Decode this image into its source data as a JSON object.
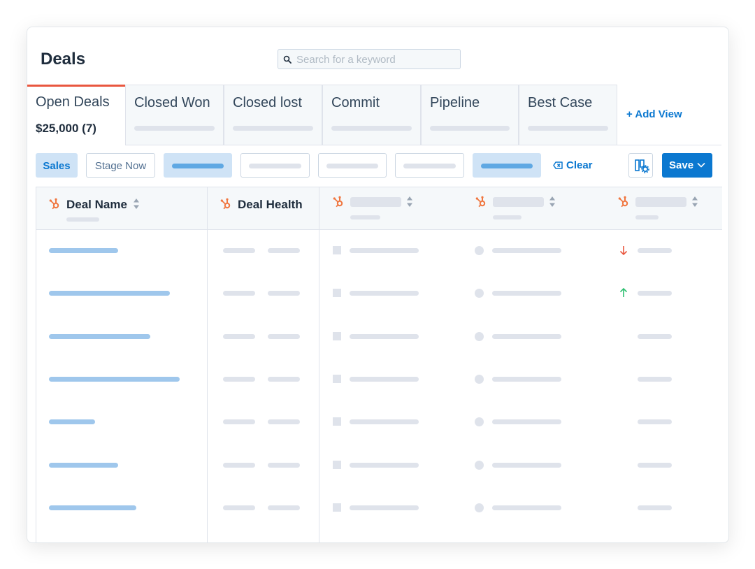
{
  "header": {
    "title": "Deals"
  },
  "search": {
    "placeholder": "Search for a keyword",
    "value": ""
  },
  "tabs": [
    {
      "label": "Open Deals",
      "value": "$25,000 (7)",
      "active": true
    },
    {
      "label": "Closed Won"
    },
    {
      "label": "Closed lost"
    },
    {
      "label": "Commit"
    },
    {
      "label": "Pipeline"
    },
    {
      "label": "Best Case"
    }
  ],
  "add_view_label": "+ Add View",
  "filters": {
    "sales_label": "Sales",
    "stage_label": "Stage Now",
    "clear_label": "Clear",
    "save_label": "Save"
  },
  "table": {
    "columns": [
      "Deal Name",
      "Deal Health"
    ],
    "rows": [
      {
        "trend": "down"
      },
      {
        "trend": "up"
      },
      {
        "trend": "none"
      },
      {
        "trend": "none"
      },
      {
        "trend": "none"
      },
      {
        "trend": "none"
      },
      {
        "trend": "none"
      }
    ]
  },
  "colors": {
    "accent": "#0b78d0",
    "tab_indicator": "#e9573f",
    "hubspot": "#f0763f",
    "trend_down": "#e9573f",
    "trend_up": "#2fbf71"
  },
  "icons": [
    "search-icon",
    "hubspot-sprocket-icon",
    "sort-icon",
    "clear-filter-icon",
    "column-settings-icon",
    "chevron-down-icon",
    "arrow-down-icon",
    "arrow-up-icon"
  ]
}
